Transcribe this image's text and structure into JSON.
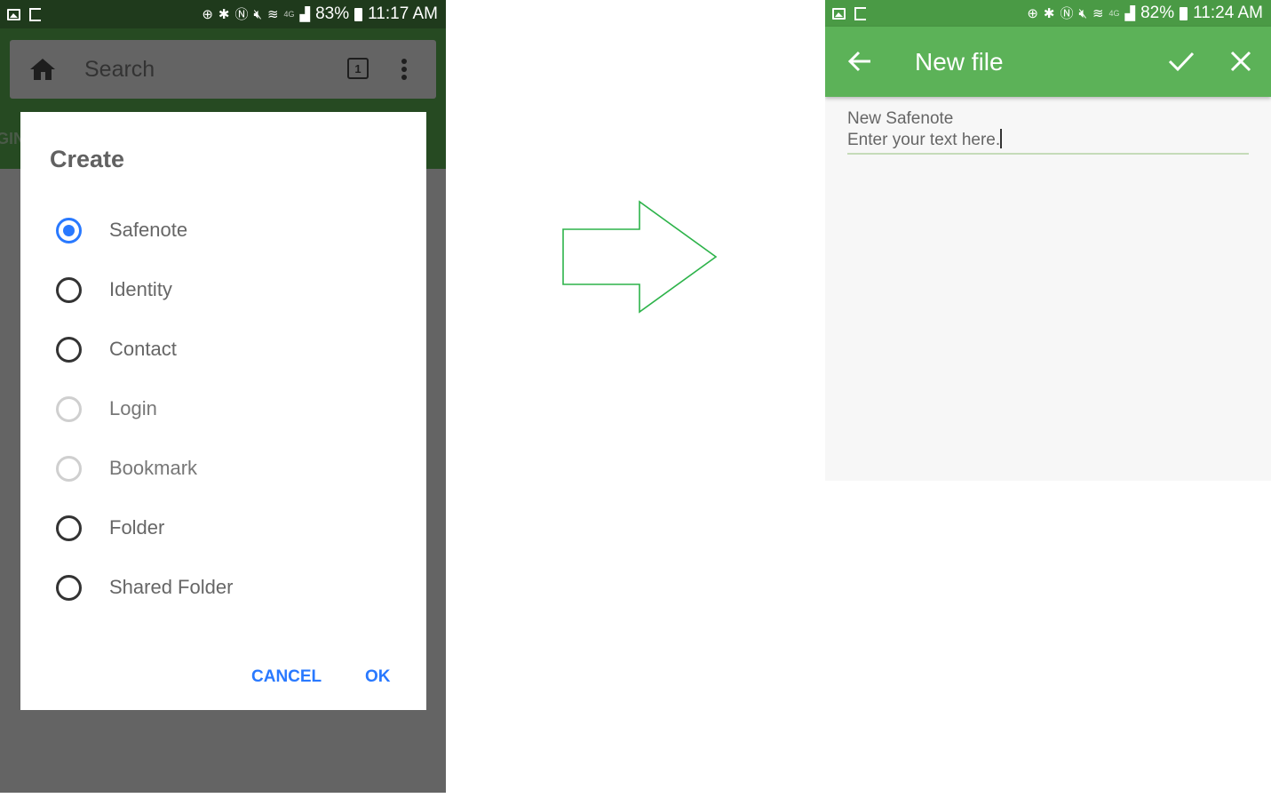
{
  "left_screen": {
    "status_bar": {
      "battery": "83%",
      "time": "11:17 AM",
      "network": "4G"
    },
    "search_bar": {
      "placeholder": "Search",
      "tab_count": "1"
    },
    "background_tab_fragment": "GIN",
    "dialog": {
      "title": "Create",
      "options": [
        {
          "label": "Safenote",
          "state": "checked"
        },
        {
          "label": "Identity",
          "state": "unchecked"
        },
        {
          "label": "Contact",
          "state": "unchecked"
        },
        {
          "label": "Login",
          "state": "disabled"
        },
        {
          "label": "Bookmark",
          "state": "disabled"
        },
        {
          "label": "Folder",
          "state": "unchecked"
        },
        {
          "label": "Shared Folder",
          "state": "unchecked"
        }
      ],
      "cancel_label": "CANCEL",
      "ok_label": "OK"
    }
  },
  "transition_arrow": {
    "icon": "arrow-right-outline",
    "color": "#2db34a"
  },
  "right_screen": {
    "status_bar": {
      "battery": "82%",
      "time": "11:24 AM",
      "network": "4G"
    },
    "toolbar": {
      "title": "New file",
      "back_icon": "arrow-left",
      "save_icon": "checkmark",
      "close_icon": "close"
    },
    "editor": {
      "title_line": "New Safenote",
      "body_line": "Enter your text here."
    }
  },
  "colors": {
    "accent_blue": "#2979ff",
    "toolbar_green": "#5cb258",
    "status_green_dark": "#1f3a1c",
    "status_green_light": "#4a9a45",
    "scrim_gray": "#646464"
  }
}
